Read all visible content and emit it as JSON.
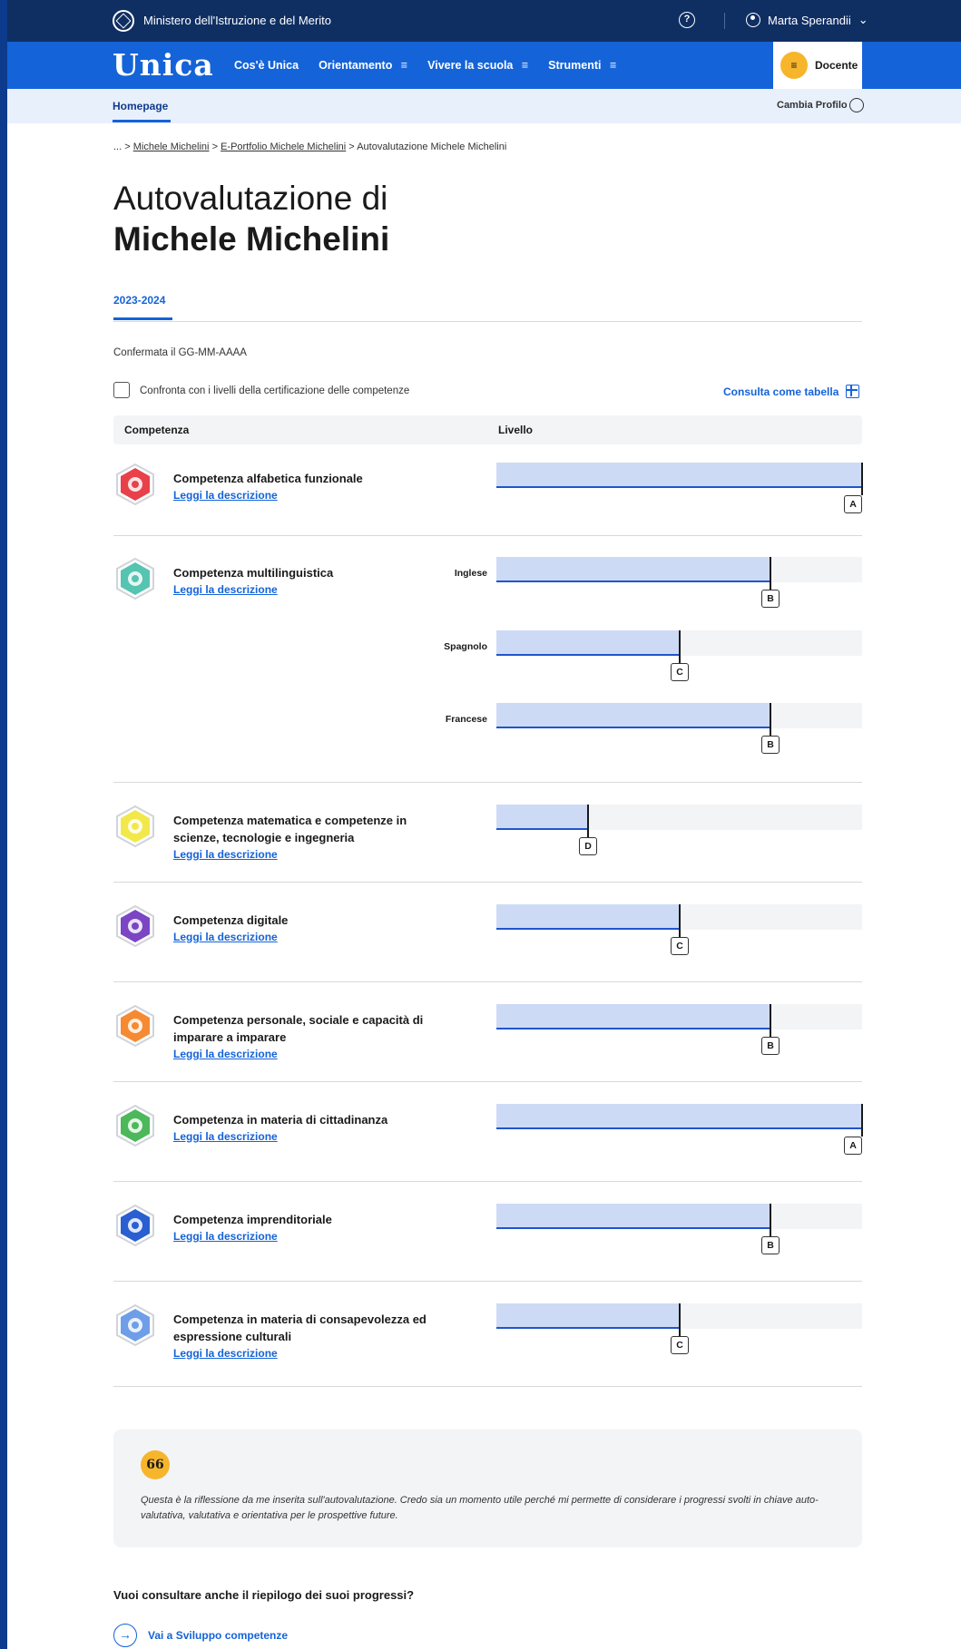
{
  "topbar": {
    "ministry": "Ministero dell'Istruzione e del Merito",
    "help_icon": "?",
    "user": "Marta Sperandii",
    "user_chevron": "⌄"
  },
  "nav": {
    "logo": "Unica",
    "items": [
      {
        "label": "Cos'è Unica"
      },
      {
        "label": "Orientamento"
      },
      {
        "label": "Vivere la scuola"
      },
      {
        "label": "Strumenti"
      }
    ],
    "profile": "Docente",
    "profile_badge": "≡"
  },
  "subnav": {
    "home": "Homepage",
    "cambia": "Cambia Profilo"
  },
  "breadcrumb": {
    "ellipsis": "...",
    "sep": ">",
    "items": [
      "Michele Michelini",
      "E-Portfolio Michele Michelini",
      "Autovalutazione Michele Michelini"
    ]
  },
  "page": {
    "title_line1": "Autovalutazione di",
    "title_line2": "Michele Michelini",
    "year_tab": "2023-2024",
    "confirmed": "Confermata il GG-MM-AAAA",
    "compare_label": "Confronta con i livelli della certificazione delle competenze",
    "consulta": "Consulta come tabella"
  },
  "table": {
    "col_competenza": "Competenza",
    "col_livello": "Livello",
    "link_label": "Leggi la descrizione",
    "rows": [
      {
        "name": "Competenza alfabetica funzionale",
        "color": "#e8414a",
        "levels": [
          {
            "lang": "",
            "value": 1.0,
            "label": "A"
          }
        ]
      },
      {
        "name": "Competenza multilinguistica",
        "color": "#55c4b0",
        "levels": [
          {
            "lang": "Inglese",
            "value": 0.75,
            "label": "B"
          },
          {
            "lang": "Spagnolo",
            "value": 0.5,
            "label": "C"
          },
          {
            "lang": "Francese",
            "value": 0.75,
            "label": "B"
          }
        ]
      },
      {
        "name": "Competenza matematica e competenze in scienze, tecnologie e ingegneria",
        "color": "#f2e84b",
        "levels": [
          {
            "lang": "",
            "value": 0.25,
            "label": "D"
          }
        ]
      },
      {
        "name": "Competenza digitale",
        "color": "#7b45c4",
        "levels": [
          {
            "lang": "",
            "value": 0.5,
            "label": "C"
          }
        ]
      },
      {
        "name": "Competenza personale, sociale e capacità di imparare a imparare",
        "color": "#f58a32",
        "levels": [
          {
            "lang": "",
            "value": 0.75,
            "label": "B"
          }
        ]
      },
      {
        "name": "Competenza in materia di cittadinanza",
        "color": "#4cb85a",
        "levels": [
          {
            "lang": "",
            "value": 1.0,
            "label": "A"
          }
        ]
      },
      {
        "name": "Competenza imprenditoriale",
        "color": "#2a5fd1",
        "levels": [
          {
            "lang": "",
            "value": 0.75,
            "label": "B"
          }
        ]
      },
      {
        "name": "Competenza in materia di consapevolezza ed espressione culturali",
        "color": "#6f9ee8",
        "levels": [
          {
            "lang": "",
            "value": 0.5,
            "label": "C"
          }
        ]
      }
    ]
  },
  "quote": {
    "icon": "66",
    "text": "Questa è la riflessione da me inserita sull'autovalutazione. Credo sia un momento utile perché mi permette di considerare i progressi svolti in chiave auto-valutativa, valutativa e orientativa per le prospettive future."
  },
  "footer": {
    "question": "Vuoi consultare anche il riepilogo dei suoi progressi?",
    "link": "Vai a Sviluppo competenze"
  }
}
